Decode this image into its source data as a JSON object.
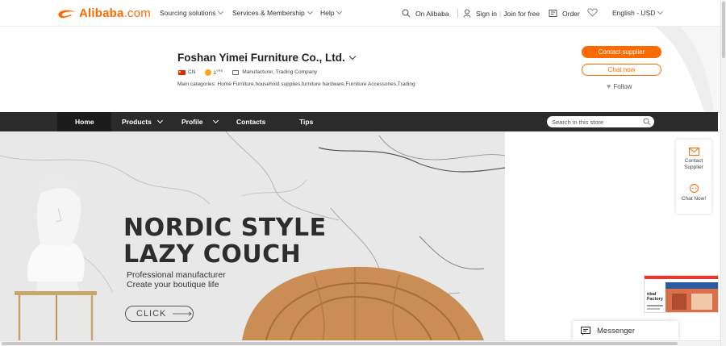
{
  "header": {
    "logo_text": "Alibaba",
    "logo_suffix": ".com",
    "nav": [
      {
        "label": "Sourcing solutions"
      },
      {
        "label": "Services & Membership"
      },
      {
        "label": "Help"
      }
    ],
    "on_alibaba": "On Alibaba",
    "sign_in": "Sign in",
    "join": "Join for free",
    "order": "Order",
    "language": "English - USD"
  },
  "company": {
    "name": "Foshan Yimei Furniture Co., Ltd.",
    "country": "CN",
    "years": "1",
    "years_unit": "YRS",
    "business_type": "Manufacturer, Trading Company",
    "main_categories": "Main categories: Home Furniture,household supplies,furniture hardware,Furniture Accessories,Trading",
    "contact_button": "Contact supplier",
    "chat_button": "Chat now",
    "follow": "Follow"
  },
  "store_nav": {
    "tabs": [
      {
        "label": "Home"
      },
      {
        "label": "Products"
      },
      {
        "label": "Profile"
      },
      {
        "label": "Contacts"
      },
      {
        "label": "Tips"
      }
    ],
    "search_placeholder": "Search in this store"
  },
  "hero": {
    "headline_1": "NORDIC STYLE",
    "headline_2": "LAZY COUCH",
    "sub_1": "Professional manufacturer",
    "sub_2": "Create your boutique life",
    "cta": "CLICK"
  },
  "side_widget": {
    "contact_1": "Contact",
    "contact_2": "Supplier",
    "chat": "Chat Now!"
  },
  "thumbnail": {
    "line_1": "nbal",
    "line_2": "Factory"
  },
  "messenger": {
    "label": "Messenger"
  },
  "colors": {
    "brand": "#ff6a00",
    "nav_bg": "#2b2b2b"
  }
}
